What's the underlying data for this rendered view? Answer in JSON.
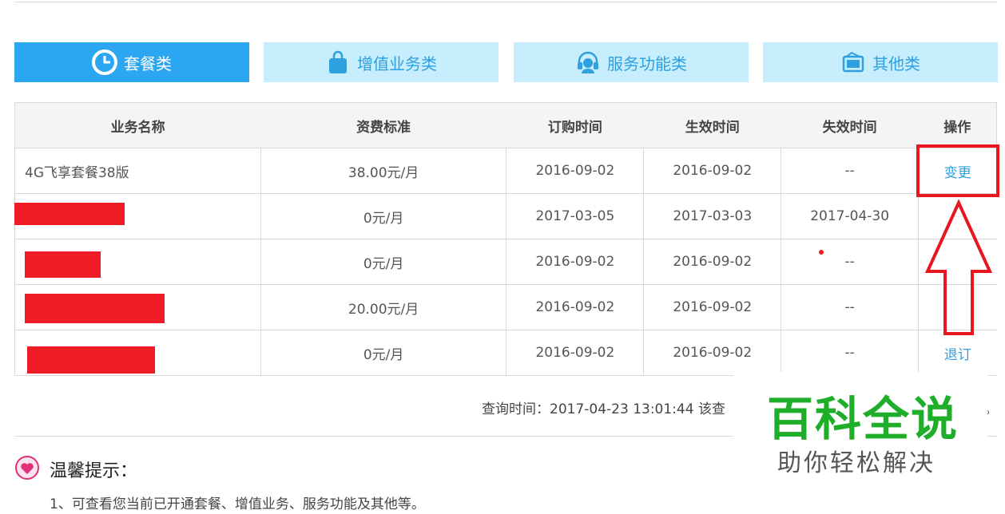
{
  "tabs": [
    {
      "label": "套餐类",
      "icon": "clock-icon",
      "active": true
    },
    {
      "label": "增值业务类",
      "icon": "shopping-bag-icon",
      "active": false
    },
    {
      "label": "服务功能类",
      "icon": "headset-icon",
      "active": false
    },
    {
      "label": "其他类",
      "icon": "card-icon",
      "active": false
    }
  ],
  "table": {
    "headers": [
      "业务名称",
      "资费标准",
      "订购时间",
      "生效时间",
      "失效时间",
      "操作"
    ],
    "rows": [
      {
        "name": "4G飞享套餐38版",
        "fee": "38.00元/月",
        "ordered": "2016-09-02",
        "effective": "2016-09-02",
        "expires": "--",
        "action": "变更"
      },
      {
        "name": "",
        "fee": "0元/月",
        "ordered": "2017-03-05",
        "effective": "2017-03-03",
        "expires": "2017-04-30",
        "action": ""
      },
      {
        "name": "",
        "fee": "0元/月",
        "ordered": "2016-09-02",
        "effective": "2016-09-02",
        "expires": "--",
        "action": ""
      },
      {
        "name": "",
        "fee": "20.00元/月",
        "ordered": "2016-09-02",
        "effective": "2016-09-02",
        "expires": "--",
        "action": ""
      },
      {
        "name": "",
        "fee": "0元/月",
        "ordered": "2016-09-02",
        "effective": "2016-09-02",
        "expires": "--",
        "action": "退订"
      }
    ]
  },
  "query": {
    "text": "查询时间：2017-04-23 13:01:44  该查",
    "tail": "。"
  },
  "tips": {
    "title": "温馨提示：",
    "item1": "1、可查看您当前已开通套餐、增值业务、服务功能及其他等。"
  },
  "watermark": {
    "big": "百科全说",
    "small": "助你轻松解决"
  },
  "colors": {
    "active_tab": "#2ba6f0",
    "tab_bg": "#c7eefc",
    "link": "#2ea0e0",
    "annotation_red": "#e8171f",
    "watermark_green": "#1fae2a"
  }
}
